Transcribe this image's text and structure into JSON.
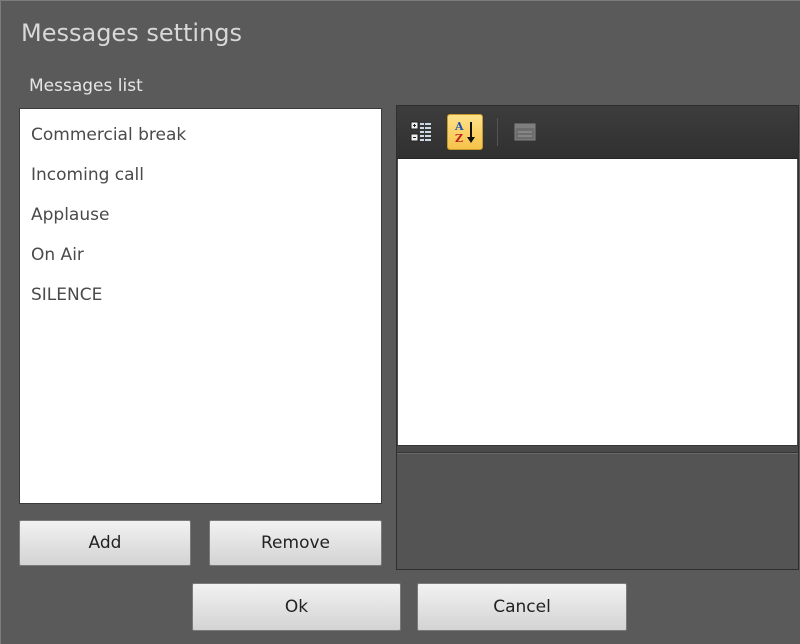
{
  "dialog": {
    "title": "Messages settings",
    "list_label": "Messages list"
  },
  "messages": [
    "Commercial break",
    "Incoming call",
    "Applause",
    "On Air",
    "SILENCE"
  ],
  "buttons": {
    "add": "Add",
    "remove": "Remove",
    "ok": "Ok",
    "cancel": "Cancel"
  },
  "property_grid": {
    "toolbar": [
      {
        "name": "categorized-view",
        "icon": "categorized-icon",
        "active": false
      },
      {
        "name": "alphabetical-sort",
        "icon": "sort-az-icon",
        "active": true
      },
      {
        "name": "property-pages",
        "icon": "property-pages-icon",
        "active": false,
        "disabled": true
      }
    ]
  },
  "colors": {
    "background": "#5a5a5a",
    "list_background": "#ffffff",
    "active_tool": "#f6c24a"
  }
}
